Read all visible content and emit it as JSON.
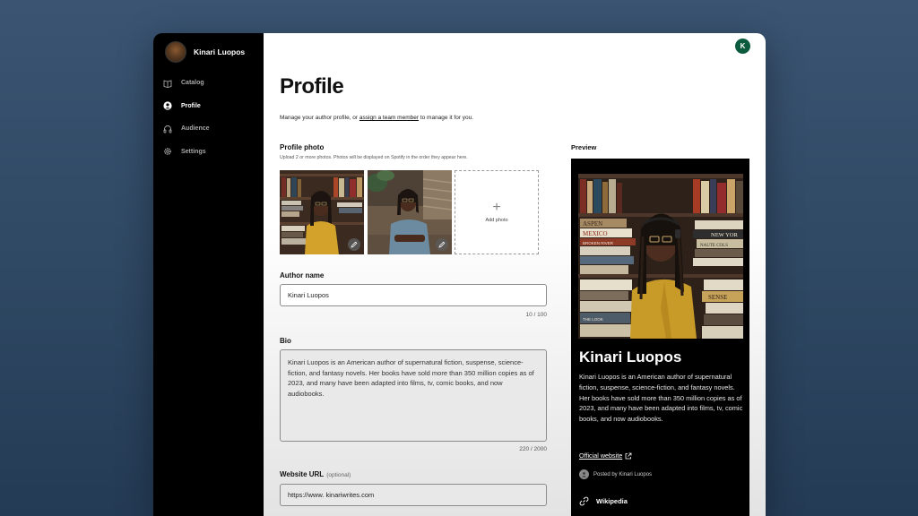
{
  "sidebar": {
    "user_name": "Kinari Luopos",
    "items": [
      {
        "label": "Catalog",
        "icon": "book-icon"
      },
      {
        "label": "Profile",
        "icon": "person-icon"
      },
      {
        "label": "Audience",
        "icon": "headphones-icon"
      },
      {
        "label": "Settings",
        "icon": "gear-icon"
      }
    ],
    "active": "Profile"
  },
  "header": {
    "account_initial": "K"
  },
  "main": {
    "title": "Profile",
    "subtitle_before": "Manage your author profile, or ",
    "subtitle_link": "assign a team member",
    "subtitle_after": " to manage it for you.",
    "profile_photo": {
      "label": "Profile photo",
      "hint": "Upload 2 or more photos. Photos will be displayed on Spotify in the order they appear here.",
      "add_label": "Add photo",
      "add_symbol": "+"
    },
    "author_name": {
      "label": "Author name",
      "value": "Kinari Luopos",
      "counter": "10 / 100"
    },
    "bio": {
      "label": "Bio",
      "value": "Kinari Luopos is an American author of supernatural fiction, suspense, science-fiction, and fantasy novels. Her books have sold more than 350 million copies as of 2023, and many have been adapted into films, tv, comic books, and now audiobooks.",
      "counter": "220 / 2000"
    },
    "website": {
      "label": "Website URL",
      "optional": "(optional)",
      "value": "https://www. kinariwrites.com"
    }
  },
  "preview": {
    "label": "Preview",
    "name": "Kinari Luopos",
    "bio": "Kinari Luopos is an American author of supernatural fiction, suspense, science-fiction, and fantasy novels. Her books have sold more than 350 million copies as of 2023, and many have been adapted into films, tv, comic books, and now audiobooks.",
    "official_link": "Official website",
    "posted_by": "Posted by Kinari Luopos",
    "wikipedia": "Wikipedia",
    "book_spines": [
      "ASPEN",
      "MEXICO",
      "BROKEN RIVER",
      "NEW YOR",
      "NAUTE COLS",
      "SENSE",
      "THE LOOK"
    ]
  },
  "colors": {
    "accent": "#0d5b3f",
    "sidebar_bg": "#000000",
    "page_bg": "#2e4762"
  }
}
